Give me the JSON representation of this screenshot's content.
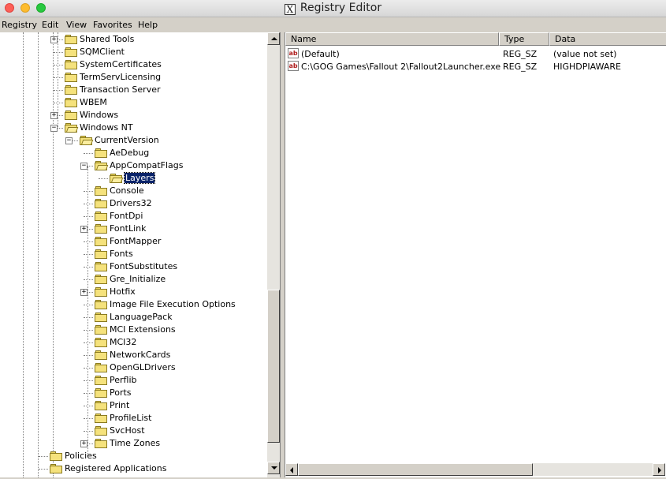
{
  "window": {
    "title": "Registry Editor",
    "x_glyph": "X"
  },
  "menu": [
    "Registry",
    "Edit",
    "View",
    "Favorites",
    "Help"
  ],
  "tree": [
    {
      "label": "Shared Tools",
      "expander": "+"
    },
    {
      "label": "SQMClient",
      "expander": ""
    },
    {
      "label": "SystemCertificates",
      "expander": ""
    },
    {
      "label": "TermServLicensing",
      "expander": ""
    },
    {
      "label": "Transaction Server",
      "expander": ""
    },
    {
      "label": "WBEM",
      "expander": ""
    },
    {
      "label": "Windows",
      "expander": "+"
    },
    {
      "label": "Windows NT",
      "expander": "−"
    },
    {
      "label": "CurrentVersion",
      "expander": "−"
    },
    {
      "label": "AeDebug",
      "expander": ""
    },
    {
      "label": "AppCompatFlags",
      "expander": "−"
    },
    {
      "label": "Layers",
      "expander": "",
      "selected": true
    },
    {
      "label": "Console",
      "expander": ""
    },
    {
      "label": "Drivers32",
      "expander": ""
    },
    {
      "label": "FontDpi",
      "expander": ""
    },
    {
      "label": "FontLink",
      "expander": "+"
    },
    {
      "label": "FontMapper",
      "expander": ""
    },
    {
      "label": "Fonts",
      "expander": ""
    },
    {
      "label": "FontSubstitutes",
      "expander": ""
    },
    {
      "label": "Gre_Initialize",
      "expander": ""
    },
    {
      "label": "Hotfix",
      "expander": "+"
    },
    {
      "label": "Image File Execution Options",
      "expander": ""
    },
    {
      "label": "LanguagePack",
      "expander": ""
    },
    {
      "label": "MCI Extensions",
      "expander": ""
    },
    {
      "label": "MCI32",
      "expander": ""
    },
    {
      "label": "NetworkCards",
      "expander": ""
    },
    {
      "label": "OpenGLDrivers",
      "expander": ""
    },
    {
      "label": "Perflib",
      "expander": ""
    },
    {
      "label": "Ports",
      "expander": ""
    },
    {
      "label": "Print",
      "expander": ""
    },
    {
      "label": "ProfileList",
      "expander": ""
    },
    {
      "label": "SvcHost",
      "expander": ""
    },
    {
      "label": "Time Zones",
      "expander": "+"
    },
    {
      "label": "Policies",
      "expander": ""
    },
    {
      "label": "Registered Applications",
      "expander": ""
    }
  ],
  "list": {
    "columns": [
      "Name",
      "Type",
      "Data"
    ],
    "rows": [
      {
        "icon": "ab",
        "name": "(Default)",
        "type": "REG_SZ",
        "data": "(value not set)"
      },
      {
        "icon": "ab",
        "name": "C:\\GOG Games\\Fallout 2\\Fallout2Launcher.exe",
        "type": "REG_SZ",
        "data": "HIGHDPIAWARE"
      }
    ]
  },
  "colors": {
    "selection": "#0a246a",
    "window_bg": "#d4d0c8"
  }
}
